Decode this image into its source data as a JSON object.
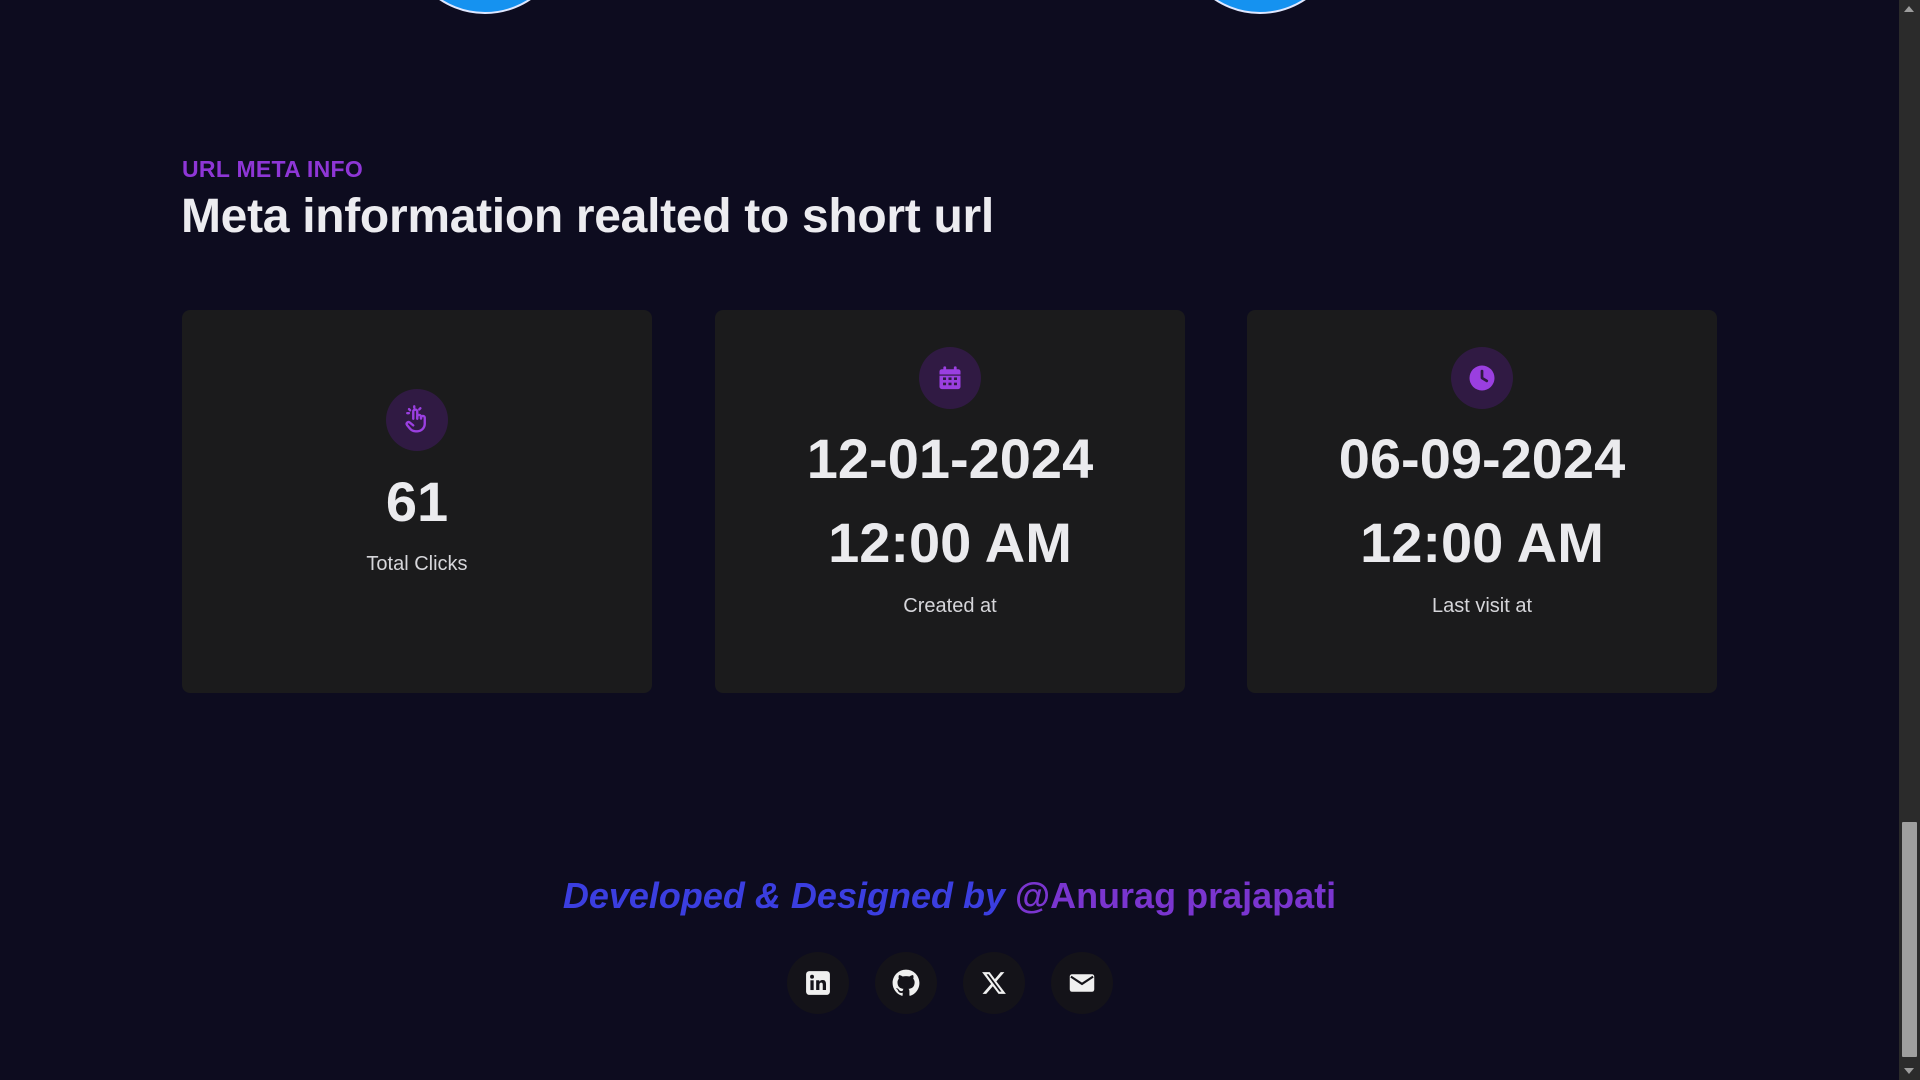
{
  "section": {
    "eyebrow": "URL META INFO",
    "heading": "Meta information realted to short url"
  },
  "cards": [
    {
      "icon": "pointer-hand-icon",
      "value_line1": "61",
      "label": "Total Clicks"
    },
    {
      "icon": "calendar-icon",
      "value_line1": "12-01-2024",
      "value_line2": "12:00 AM",
      "label": "Created at"
    },
    {
      "icon": "clock-icon",
      "value_line1": "06-09-2024",
      "value_line2": "12:00 AM",
      "label": "Last visit at"
    }
  ],
  "footer": {
    "credit_prefix": "Developed & Designed by ",
    "credit_author": "@Anurag prajapati",
    "social": [
      "linkedin-icon",
      "github-icon",
      "x-twitter-icon",
      "mail-icon"
    ]
  },
  "colors": {
    "background": "#0d0c1f",
    "accent_purple": "#8e36d6",
    "card_bg": "#1b1b1c",
    "credit_blue": "#3b3ee0",
    "credit_purple": "#7a35cf"
  }
}
